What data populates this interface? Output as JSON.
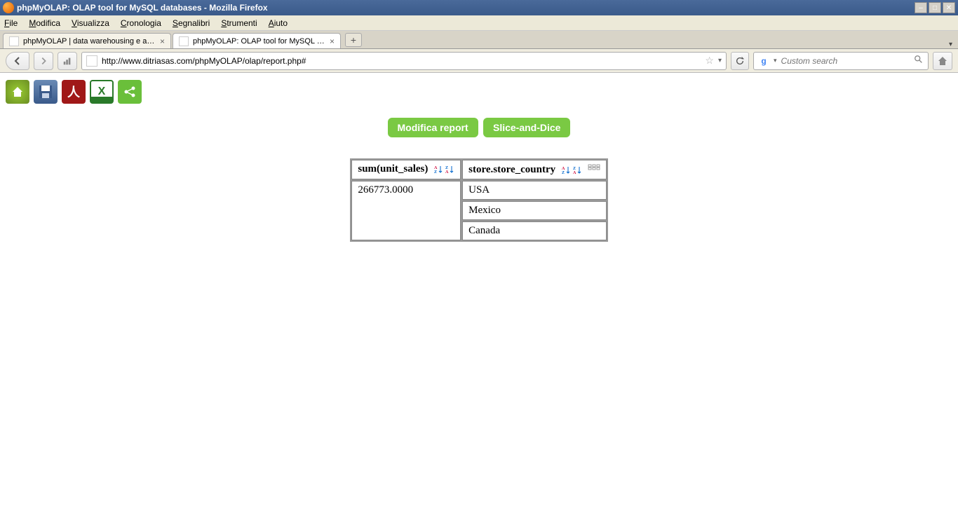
{
  "window": {
    "title": "phpMyOLAP: OLAP tool for MySQL databases - Mozilla Firefox"
  },
  "menu": {
    "items": [
      "File",
      "Modifica",
      "Visualizza",
      "Cronologia",
      "Segnalibri",
      "Strumenti",
      "Aiuto"
    ]
  },
  "tabs": [
    {
      "label": "phpMyOLAP | data warehousing e analisi ...",
      "active": false
    },
    {
      "label": "phpMyOLAP: OLAP tool for MySQL datab...",
      "active": true
    }
  ],
  "nav": {
    "url": "http://www.ditriasas.com/phpMyOLAP/olap/report.php#",
    "search_placeholder": "Custom search"
  },
  "toolbar": {
    "home": "home",
    "save": "save",
    "pdf": "pdf",
    "excel": "excel",
    "share": "share"
  },
  "buttons": {
    "modify_report": "Modifica report",
    "slice_dice": "Slice-and-Dice"
  },
  "report": {
    "col1_header": "sum(unit_sales)",
    "col2_header": "store.store_country",
    "rows": [
      {
        "measure": "266773.0000",
        "country": "USA"
      },
      {
        "measure": "",
        "country": "Mexico"
      },
      {
        "measure": "",
        "country": "Canada"
      }
    ]
  }
}
